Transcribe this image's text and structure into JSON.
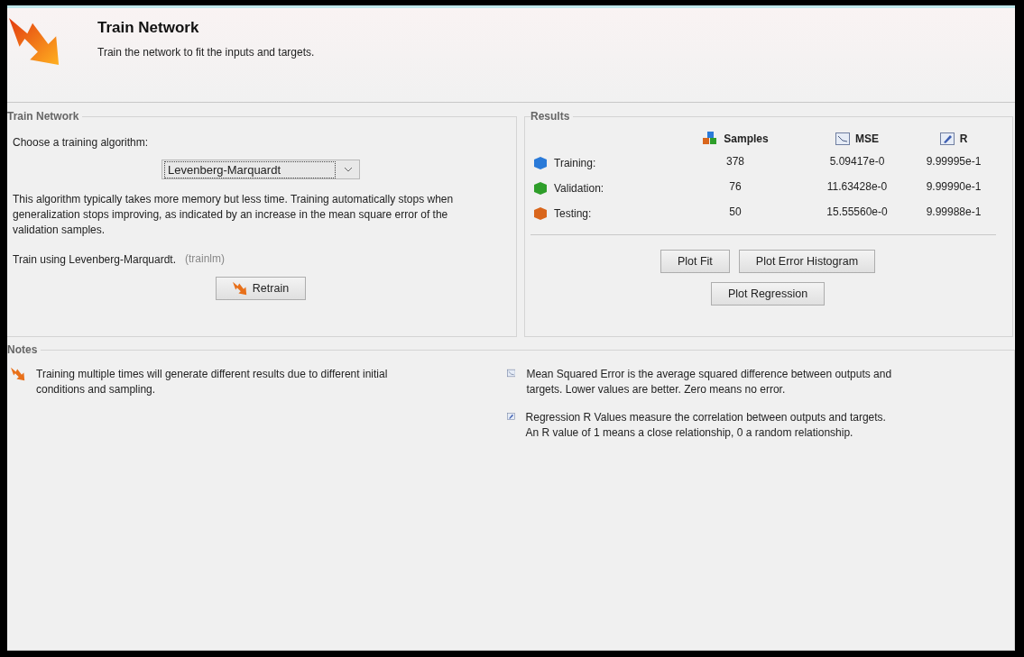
{
  "header": {
    "title": "Train Network",
    "subtitle": "Train the network to fit the inputs and targets."
  },
  "train_panel": {
    "title": "Train Network",
    "prompt": "Choose a training algorithm:",
    "algorithm": {
      "value": "Levenberg-Marquardt"
    },
    "description": "This algorithm typically takes more memory but less time. Training automatically stops when generalization stops improving, as indicated by an increase in the mean square error of the validation samples.",
    "method": "Train using Levenberg-Marquardt.",
    "method_code": "(trainlm)",
    "retrain_button": "Retrain"
  },
  "results": {
    "title": "Results",
    "columns": [
      {
        "kind": "samples",
        "label": "Samples"
      },
      {
        "kind": "mse",
        "label": "MSE"
      },
      {
        "kind": "r",
        "label": "R"
      }
    ],
    "rows": [
      {
        "label": "Training:",
        "color": "#2a7ad8",
        "cells": [
          "378",
          "5.09417e-0",
          "9.99995e-1"
        ]
      },
      {
        "label": "Validation:",
        "color": "#2e9e2a",
        "cells": [
          "76",
          "11.63428e-0",
          "9.99990e-1"
        ]
      },
      {
        "label": "Testing:",
        "color": "#d9661c",
        "cells": [
          "50",
          "15.55560e-0",
          "9.99988e-1"
        ]
      }
    ],
    "buttons": [
      "Plot Fit",
      "Plot Error Histogram",
      "Plot Regression"
    ]
  },
  "notes": {
    "title": "Notes",
    "left": [
      {
        "kind": "retrain",
        "text": "Training multiple times will generate different results due to different initial conditions and sampling."
      }
    ],
    "right": [
      {
        "kind": "mse",
        "text": "Mean Squared Error is the average squared difference between outputs and targets. Lower values are better. Zero means no error."
      },
      {
        "kind": "r",
        "text": "Regression R Values measure the correlation between outputs and targets. An R value of 1 means a close relationship, 0 a random relationship."
      }
    ]
  }
}
